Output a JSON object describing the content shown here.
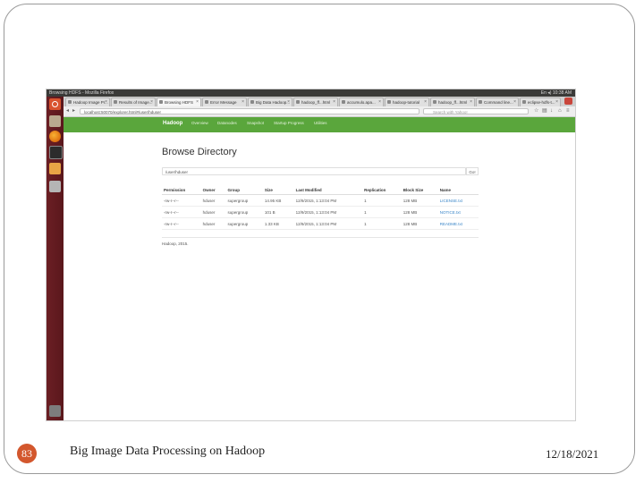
{
  "os": {
    "window_title": "Browsing HDFS - Mozilla Firefox",
    "indicators": "En ◂) 10:38 AM"
  },
  "launcher": {
    "items": [
      "ubuntu-dash",
      "files",
      "firefox",
      "terminal",
      "libreoffice",
      "settings",
      "trash"
    ]
  },
  "browser": {
    "tabs": [
      {
        "label": "Hadoop Image Pr...",
        "active": false
      },
      {
        "label": "Results of Image...",
        "active": false
      },
      {
        "label": "Browsing HDFS",
        "active": true
      },
      {
        "label": "Error Message",
        "active": false
      },
      {
        "label": "Big Data Hadoop...",
        "active": false
      },
      {
        "label": "hadoop_ff...html",
        "active": false
      },
      {
        "label": "accumulo.apa...",
        "active": false
      },
      {
        "label": "hadoop-tutorial",
        "active": false
      },
      {
        "label": "hadoop_ff...html",
        "active": false
      },
      {
        "label": "Command line...",
        "active": false
      },
      {
        "label": "eclipse-hdfs-t...",
        "active": false
      }
    ],
    "url": "localhost:50070/explorer.html#/user/hduser",
    "search_placeholder": "Search with Yahoo!"
  },
  "hadoop": {
    "brand": "Hadoop",
    "menu": [
      "Overview",
      "Datanodes",
      "Snapshot",
      "Startup Progress",
      "Utilities"
    ],
    "page_title": "Browse Directory",
    "directory_value": "/user/hduser",
    "go_label": "Go!",
    "columns": [
      "Permission",
      "Owner",
      "Group",
      "Size",
      "Last Modified",
      "Replication",
      "Block Size",
      "Name"
    ],
    "rows": [
      [
        "-rw-r--r--",
        "hduser",
        "supergroup",
        "14.95 KB",
        "12/9/2015, 1:13:04 PM",
        "1",
        "128 MB",
        "LICENSE.txt"
      ],
      [
        "-rw-r--r--",
        "hduser",
        "supergroup",
        "101 B",
        "12/9/2015, 1:13:04 PM",
        "1",
        "128 MB",
        "NOTICE.txt"
      ],
      [
        "-rw-r--r--",
        "hduser",
        "supergroup",
        "1.33 KB",
        "12/9/2015, 1:13:04 PM",
        "1",
        "128 MB",
        "README.txt"
      ]
    ],
    "footer": "Hadoop, 2015."
  },
  "slide": {
    "number": "83",
    "caption": "Big Image Data Processing on Hadoop",
    "date": "12/18/2021",
    "number_color": "#d3572d"
  }
}
